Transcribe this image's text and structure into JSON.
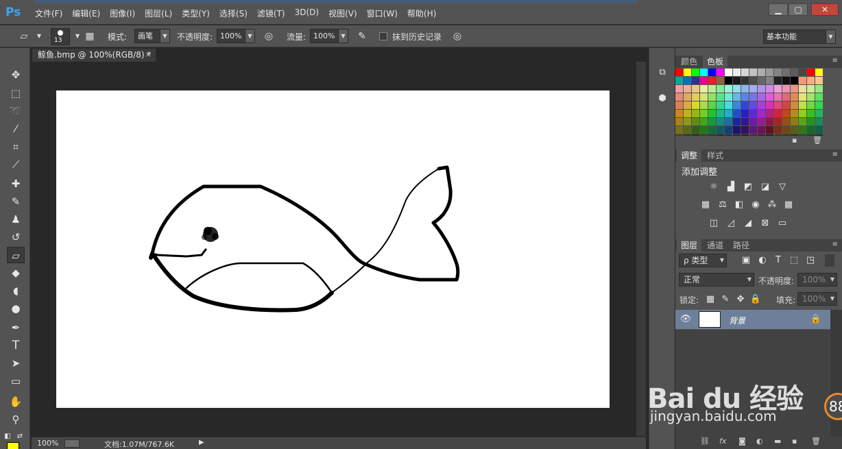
{
  "app": {
    "logo": "Ps"
  },
  "menu": [
    "文件(F)",
    "编辑(E)",
    "图像(I)",
    "图层(L)",
    "类型(Y)",
    "选择(S)",
    "滤镜(T)",
    "3D(D)",
    "视图(V)",
    "窗口(W)",
    "帮助(H)"
  ],
  "window_controls": {
    "minimize": "▁",
    "restore": "▢",
    "close": "✕"
  },
  "options": {
    "brush_size": "13",
    "mode_label": "模式:",
    "mode_value": "画笔",
    "opacity_label": "不透明度:",
    "opacity_value": "100%",
    "flow_label": "流量:",
    "flow_value": "100%",
    "history_label": "抹到历史记录",
    "workspace": "基本功能"
  },
  "document": {
    "tab_title": "鲸鱼.bmp @ 100%(RGB/8) *",
    "close": "×",
    "zoom": "100%",
    "doc_size": "文档:1.07M/767.6K"
  },
  "toolbar": {
    "tools": [
      "move",
      "marquee",
      "lasso",
      "quick-select",
      "crop",
      "eyedropper",
      "healing",
      "brush",
      "stamp",
      "history-brush",
      "eraser",
      "paint-bucket",
      "blur",
      "dodge",
      "pen",
      "type",
      "path-select",
      "shape",
      "hand",
      "zoom"
    ],
    "type_glyph": "T",
    "active_tool": "eraser",
    "foreground_color": "#ffff00"
  },
  "swatches_panel": {
    "tabs": [
      "颜色",
      "色板"
    ],
    "active": "色板"
  },
  "adjustments_panel": {
    "tabs": [
      "调整",
      "样式"
    ],
    "active": "调整",
    "title": "添加调整"
  },
  "layers_panel": {
    "tabs": [
      "图层",
      "通道",
      "路径"
    ],
    "active": "图层",
    "filter_kind": "ρ 类型",
    "blend_mode": "正常",
    "opacity_label": "不透明度:",
    "opacity_value": "100%",
    "lock_label": "锁定:",
    "fill_label": "填充:",
    "fill_value": "100%",
    "layer_name": "背景",
    "footer_glyph": "fx"
  },
  "watermark": {
    "brand": "Bai du 经验",
    "url": "jingyan.baidu.com",
    "badge": "88"
  }
}
